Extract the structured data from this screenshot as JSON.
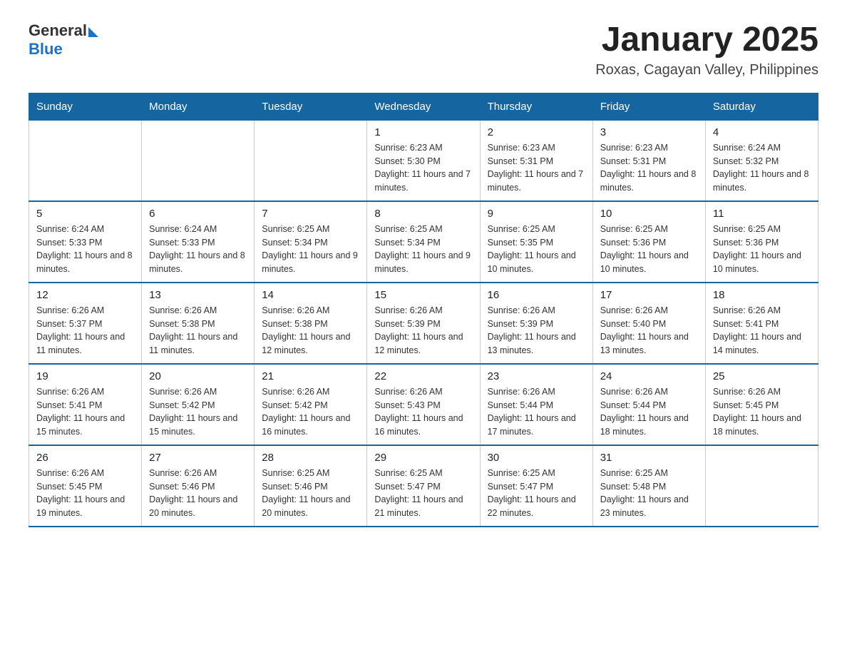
{
  "header": {
    "logo_general": "General",
    "logo_blue": "Blue",
    "title": "January 2025",
    "subtitle": "Roxas, Cagayan Valley, Philippines"
  },
  "days_of_week": [
    "Sunday",
    "Monday",
    "Tuesday",
    "Wednesday",
    "Thursday",
    "Friday",
    "Saturday"
  ],
  "weeks": [
    [
      {
        "day": "",
        "info": ""
      },
      {
        "day": "",
        "info": ""
      },
      {
        "day": "",
        "info": ""
      },
      {
        "day": "1",
        "info": "Sunrise: 6:23 AM\nSunset: 5:30 PM\nDaylight: 11 hours and 7 minutes."
      },
      {
        "day": "2",
        "info": "Sunrise: 6:23 AM\nSunset: 5:31 PM\nDaylight: 11 hours and 7 minutes."
      },
      {
        "day": "3",
        "info": "Sunrise: 6:23 AM\nSunset: 5:31 PM\nDaylight: 11 hours and 8 minutes."
      },
      {
        "day": "4",
        "info": "Sunrise: 6:24 AM\nSunset: 5:32 PM\nDaylight: 11 hours and 8 minutes."
      }
    ],
    [
      {
        "day": "5",
        "info": "Sunrise: 6:24 AM\nSunset: 5:33 PM\nDaylight: 11 hours and 8 minutes."
      },
      {
        "day": "6",
        "info": "Sunrise: 6:24 AM\nSunset: 5:33 PM\nDaylight: 11 hours and 8 minutes."
      },
      {
        "day": "7",
        "info": "Sunrise: 6:25 AM\nSunset: 5:34 PM\nDaylight: 11 hours and 9 minutes."
      },
      {
        "day": "8",
        "info": "Sunrise: 6:25 AM\nSunset: 5:34 PM\nDaylight: 11 hours and 9 minutes."
      },
      {
        "day": "9",
        "info": "Sunrise: 6:25 AM\nSunset: 5:35 PM\nDaylight: 11 hours and 10 minutes."
      },
      {
        "day": "10",
        "info": "Sunrise: 6:25 AM\nSunset: 5:36 PM\nDaylight: 11 hours and 10 minutes."
      },
      {
        "day": "11",
        "info": "Sunrise: 6:25 AM\nSunset: 5:36 PM\nDaylight: 11 hours and 10 minutes."
      }
    ],
    [
      {
        "day": "12",
        "info": "Sunrise: 6:26 AM\nSunset: 5:37 PM\nDaylight: 11 hours and 11 minutes."
      },
      {
        "day": "13",
        "info": "Sunrise: 6:26 AM\nSunset: 5:38 PM\nDaylight: 11 hours and 11 minutes."
      },
      {
        "day": "14",
        "info": "Sunrise: 6:26 AM\nSunset: 5:38 PM\nDaylight: 11 hours and 12 minutes."
      },
      {
        "day": "15",
        "info": "Sunrise: 6:26 AM\nSunset: 5:39 PM\nDaylight: 11 hours and 12 minutes."
      },
      {
        "day": "16",
        "info": "Sunrise: 6:26 AM\nSunset: 5:39 PM\nDaylight: 11 hours and 13 minutes."
      },
      {
        "day": "17",
        "info": "Sunrise: 6:26 AM\nSunset: 5:40 PM\nDaylight: 11 hours and 13 minutes."
      },
      {
        "day": "18",
        "info": "Sunrise: 6:26 AM\nSunset: 5:41 PM\nDaylight: 11 hours and 14 minutes."
      }
    ],
    [
      {
        "day": "19",
        "info": "Sunrise: 6:26 AM\nSunset: 5:41 PM\nDaylight: 11 hours and 15 minutes."
      },
      {
        "day": "20",
        "info": "Sunrise: 6:26 AM\nSunset: 5:42 PM\nDaylight: 11 hours and 15 minutes."
      },
      {
        "day": "21",
        "info": "Sunrise: 6:26 AM\nSunset: 5:42 PM\nDaylight: 11 hours and 16 minutes."
      },
      {
        "day": "22",
        "info": "Sunrise: 6:26 AM\nSunset: 5:43 PM\nDaylight: 11 hours and 16 minutes."
      },
      {
        "day": "23",
        "info": "Sunrise: 6:26 AM\nSunset: 5:44 PM\nDaylight: 11 hours and 17 minutes."
      },
      {
        "day": "24",
        "info": "Sunrise: 6:26 AM\nSunset: 5:44 PM\nDaylight: 11 hours and 18 minutes."
      },
      {
        "day": "25",
        "info": "Sunrise: 6:26 AM\nSunset: 5:45 PM\nDaylight: 11 hours and 18 minutes."
      }
    ],
    [
      {
        "day": "26",
        "info": "Sunrise: 6:26 AM\nSunset: 5:45 PM\nDaylight: 11 hours and 19 minutes."
      },
      {
        "day": "27",
        "info": "Sunrise: 6:26 AM\nSunset: 5:46 PM\nDaylight: 11 hours and 20 minutes."
      },
      {
        "day": "28",
        "info": "Sunrise: 6:25 AM\nSunset: 5:46 PM\nDaylight: 11 hours and 20 minutes."
      },
      {
        "day": "29",
        "info": "Sunrise: 6:25 AM\nSunset: 5:47 PM\nDaylight: 11 hours and 21 minutes."
      },
      {
        "day": "30",
        "info": "Sunrise: 6:25 AM\nSunset: 5:47 PM\nDaylight: 11 hours and 22 minutes."
      },
      {
        "day": "31",
        "info": "Sunrise: 6:25 AM\nSunset: 5:48 PM\nDaylight: 11 hours and 23 minutes."
      },
      {
        "day": "",
        "info": ""
      }
    ]
  ]
}
